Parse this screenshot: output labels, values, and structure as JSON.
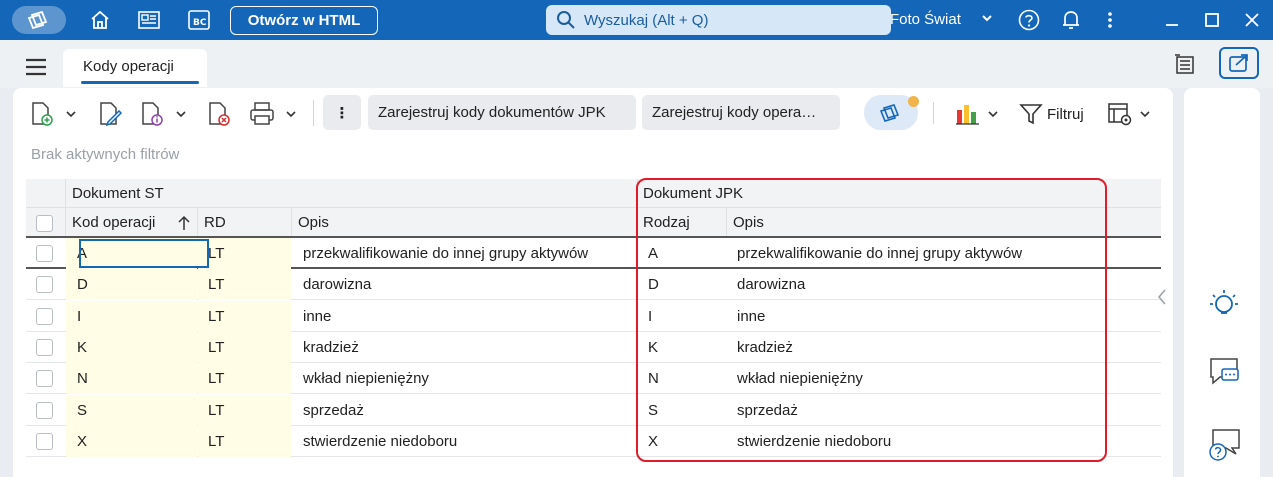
{
  "topbar": {
    "open_html_label": "Otwórz w HTML",
    "search_placeholder": "Wyszukaj (Alt + Q)",
    "company": "Foto Świat",
    "icons": [
      "app-logo-icon",
      "home-icon",
      "news-icon",
      "bc-icon",
      "search-icon",
      "chevron-down-icon",
      "help-icon",
      "bell-icon",
      "more-vert-icon",
      "minimize-icon",
      "maximize-icon",
      "close-icon"
    ]
  },
  "tabs": [
    {
      "label": "Kody operacji"
    }
  ],
  "toolbar": {
    "btn_register_jpk_docs": "Zarejestruj kody dokumentów JPK",
    "btn_register_ops": "Zarejestruj kody opera…",
    "filter_label": "Filtruj",
    "more": "⋮"
  },
  "filter_status": "Brak aktywnych filtrów",
  "grid": {
    "group_st": "Dokument ST",
    "group_jpk": "Dokument JPK",
    "col_code": "Kod operacji",
    "col_rd": "RD",
    "col_desc": "Opis",
    "col_kind": "Rodzaj",
    "col_desc2": "Opis",
    "rows": [
      {
        "code": "A",
        "rd": "LT",
        "desc": "przekwalifikowanie do innej grupy aktywów",
        "kind": "A",
        "desc2": "przekwalifikowanie do innej grupy aktywów"
      },
      {
        "code": "D",
        "rd": "LT",
        "desc": "darowizna",
        "kind": "D",
        "desc2": "darowizna"
      },
      {
        "code": "I",
        "rd": "LT",
        "desc": "inne",
        "kind": "I",
        "desc2": "inne"
      },
      {
        "code": "K",
        "rd": "LT",
        "desc": "kradzież",
        "kind": "K",
        "desc2": "kradzież"
      },
      {
        "code": "N",
        "rd": "LT",
        "desc": "wkład niepieniężny",
        "kind": "N",
        "desc2": "wkład niepieniężny"
      },
      {
        "code": "S",
        "rd": "LT",
        "desc": "sprzedaż",
        "kind": "S",
        "desc2": "sprzedaż"
      },
      {
        "code": "X",
        "rd": "LT",
        "desc": "stwierdzenie niedoboru",
        "kind": "X",
        "desc2": "stwierdzenie niedoboru"
      }
    ]
  },
  "colors": {
    "brand": "#1467b8",
    "highlight": "#e21b2a",
    "editable": "#fffde6"
  }
}
